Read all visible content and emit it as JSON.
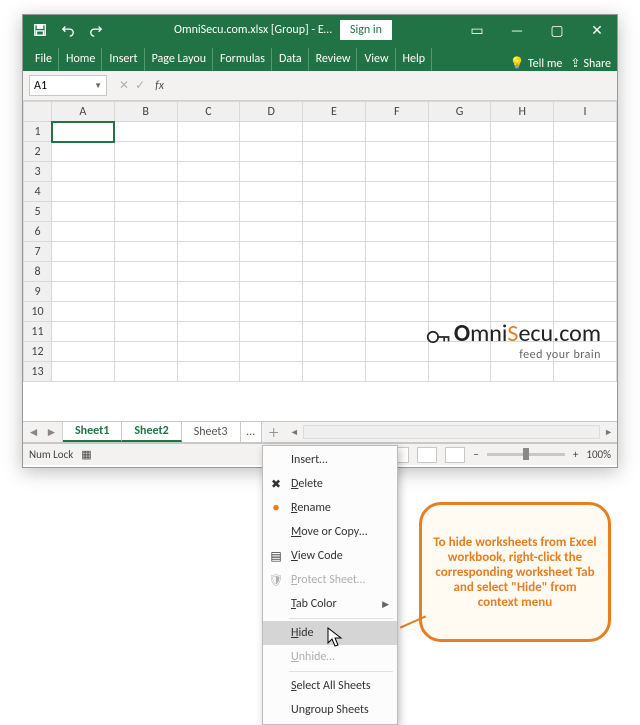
{
  "titlebar": {
    "doc_title": "OmniSecu.com.xlsx [Group] - E…",
    "signin": "Sign in"
  },
  "ribbon": {
    "tabs": [
      "File",
      "Home",
      "Insert",
      "Page Layou",
      "Formulas",
      "Data",
      "Review",
      "View",
      "Help"
    ],
    "tellme": "Tell me",
    "share": "Share"
  },
  "formula_bar": {
    "namebox": "A1",
    "fx": "fx",
    "value": ""
  },
  "grid": {
    "columns": [
      "A",
      "B",
      "C",
      "D",
      "E",
      "F",
      "G",
      "H",
      "I"
    ],
    "rows": [
      "1",
      "2",
      "3",
      "4",
      "5",
      "6",
      "7",
      "8",
      "9",
      "10",
      "11",
      "12",
      "13"
    ],
    "active_cell": "A1"
  },
  "watermark": {
    "brand": "OmniSecu.com",
    "tag": "feed your brain"
  },
  "sheet_tabs": {
    "nav_left": "◄",
    "nav_right": "►",
    "tabs": [
      {
        "label": "Sheet1",
        "grouped": true
      },
      {
        "label": "Sheet2",
        "grouped": true
      },
      {
        "label": "Sheet3",
        "grouped": false
      }
    ],
    "ellipsis": "…",
    "new_sheet": "＋"
  },
  "statusbar": {
    "numlock": "Num Lock",
    "minus": "−",
    "plus": "+",
    "zoom": "100%"
  },
  "context_menu": {
    "insert": "Insert…",
    "delete": "Delete",
    "rename": "Rename",
    "move": "Move or Copy…",
    "viewcode": "View Code",
    "protect": "Protect Sheet…",
    "tabcolor": "Tab Color",
    "hide": "Hide",
    "unhide": "Unhide…",
    "selectall": "Select All Sheets",
    "ungroup": "Ungroup Sheets"
  },
  "callout": {
    "text": "To hide worksheets from Excel workbook, right-click the corresponding worksheet Tab and select \"Hide\" from context menu"
  }
}
